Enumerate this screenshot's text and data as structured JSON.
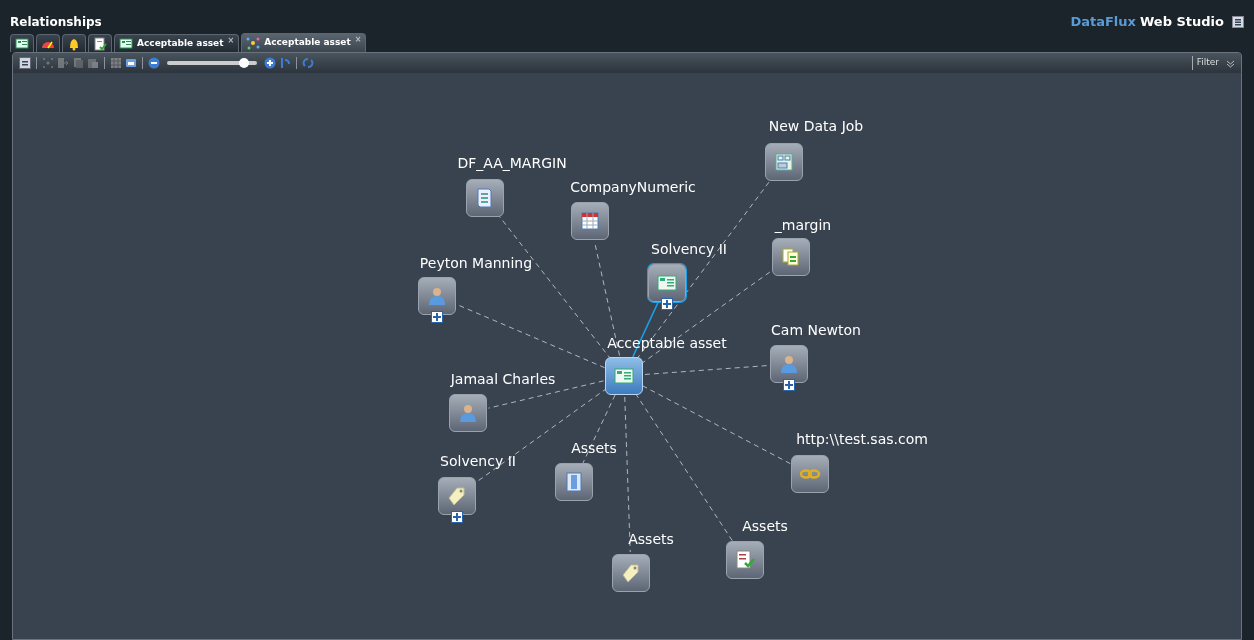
{
  "window": {
    "title": "Relationships"
  },
  "brand": {
    "prefix": "DataFlux",
    "name": "Web Studio"
  },
  "tabs": [
    {
      "kind": "home",
      "selected": false
    },
    {
      "kind": "monitor",
      "selected": false
    },
    {
      "kind": "alerts",
      "selected": false
    },
    {
      "kind": "tasks",
      "selected": false
    },
    {
      "kind": "asset",
      "label": "Acceptable asset",
      "close": "×",
      "selected": false
    },
    {
      "kind": "graph",
      "label": "Acceptable asset",
      "close": "×",
      "selected": true
    }
  ],
  "toolbar": {
    "tools": [
      {
        "kind": "collapse",
        "disabled": false
      },
      {
        "kind": "layout",
        "disabled": true
      },
      {
        "kind": "export",
        "disabled": true
      },
      {
        "kind": "copy",
        "disabled": true
      },
      {
        "kind": "paste",
        "disabled": true
      },
      {
        "kind": "grid",
        "disabled": true
      },
      {
        "kind": "window",
        "disabled": false
      },
      {
        "kind": "zoom-out",
        "disabled": false
      },
      {
        "kind": "zoom",
        "level": 0.86
      },
      {
        "kind": "zoom-in",
        "disabled": false
      },
      {
        "kind": "reset",
        "disabled": false
      },
      {
        "kind": "refresh",
        "disabled": false
      }
    ],
    "filter": "Filter"
  },
  "graph": {
    "nodes": [
      {
        "label": "DF_AA_MARGIN",
        "kind": "report",
        "expandable": false,
        "highlighted_link": false
      },
      {
        "label": "CompanyNumeric",
        "kind": "table",
        "expandable": false,
        "highlighted_link": false
      },
      {
        "label": "New Data Job",
        "kind": "job",
        "expandable": false,
        "highlighted_link": false
      },
      {
        "label": "Solvency II",
        "kind": "asset",
        "expandable": true,
        "highlighted_link": true
      },
      {
        "label": "_margin",
        "kind": "fields",
        "expandable": false,
        "highlighted_link": false
      },
      {
        "label": "Peyton Manning",
        "kind": "person",
        "expandable": true,
        "highlighted_link": false
      },
      {
        "label": "Acceptable asset",
        "kind": "focus",
        "expandable": false,
        "highlighted_link": false
      },
      {
        "label": "Cam Newton",
        "kind": "person",
        "expandable": true,
        "highlighted_link": false
      },
      {
        "label": "Jamaal Charles",
        "kind": "person",
        "expandable": false,
        "highlighted_link": false
      },
      {
        "label": "Solvency II",
        "kind": "tag",
        "expandable": true,
        "highlighted_link": false
      },
      {
        "label": "Assets",
        "kind": "film",
        "expandable": false,
        "highlighted_link": false
      },
      {
        "label": "http:\\\\test.sas.com",
        "kind": "link",
        "expandable": false,
        "highlighted_link": false
      },
      {
        "label": "Assets",
        "kind": "tag",
        "expandable": false,
        "highlighted_link": false
      },
      {
        "label": "Assets",
        "kind": "rule",
        "expandable": false,
        "highlighted_link": false
      }
    ]
  }
}
